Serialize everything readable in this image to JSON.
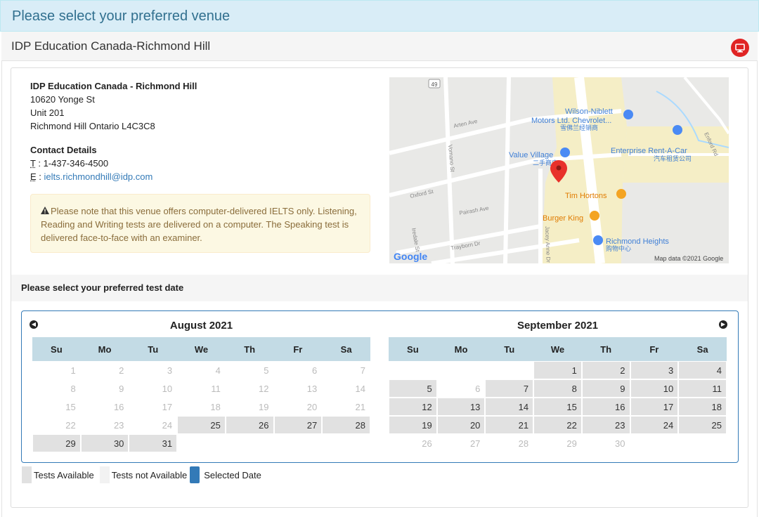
{
  "header": {
    "title": "Please select your preferred venue"
  },
  "venue_bar": {
    "name": "IDP Education Canada-Richmond Hill",
    "icon": "monitor-icon",
    "icon_color": "#e02424"
  },
  "address": {
    "title": "IDP Education Canada - Richmond Hill",
    "line1": "10620 Yonge St",
    "line2": "Unit 201",
    "line3": "Richmond Hill Ontario L4C3C8"
  },
  "contact": {
    "header": "Contact Details",
    "tel_prefix": "T",
    "tel": "1-437-346-4500",
    "email_prefix": "E",
    "email": "ielts.richmondhill@idp.com"
  },
  "note": {
    "icon": "warning-icon",
    "text": "Please note that this venue offers computer-delivered IELTS only. Listening, Reading and Writing tests are delivered on a computer. The Speaking test is delivered face-to-face with an examiner."
  },
  "map": {
    "labels": {
      "route": "49",
      "arten": "Arten Ave",
      "vomano": "Vomano St",
      "oxford": "Oxford St",
      "pairash": "Pairash Ave",
      "trayborn": "Trayborn Dr",
      "iredale": "Iredale St",
      "jacey": "Jacey Anne Dr",
      "enford": "Enford Rd",
      "wilson1": "Wilson-Niblett",
      "wilson2": "Motors Ltd. Chevrolet...",
      "wilson3": "雪佛兰经销商",
      "enterprise1": "Enterprise Rent-A-Car",
      "enterprise2": "汽车租赁公司",
      "value1": "Value Village",
      "value2": "二手商店",
      "tim": "Tim Hortons",
      "burger": "Burger King",
      "heights1": "Richmond Heights",
      "heights2": "购物中心",
      "google": "Google",
      "credit": "Map data ©2021 Google"
    }
  },
  "date_strip": {
    "label": "Please select your preferred test date"
  },
  "weekdays": [
    "Su",
    "Mo",
    "Tu",
    "We",
    "Th",
    "Fr",
    "Sa"
  ],
  "nav": {
    "prev_icon": "prev-arrow-icon",
    "next_icon": "next-arrow-icon"
  },
  "calendars": [
    {
      "title": "August 2021",
      "weeks": [
        [
          {
            "d": "1",
            "a": false
          },
          {
            "d": "2",
            "a": false
          },
          {
            "d": "3",
            "a": false
          },
          {
            "d": "4",
            "a": false
          },
          {
            "d": "5",
            "a": false
          },
          {
            "d": "6",
            "a": false
          },
          {
            "d": "7",
            "a": false
          }
        ],
        [
          {
            "d": "8",
            "a": false
          },
          {
            "d": "9",
            "a": false
          },
          {
            "d": "10",
            "a": false
          },
          {
            "d": "11",
            "a": false
          },
          {
            "d": "12",
            "a": false
          },
          {
            "d": "13",
            "a": false
          },
          {
            "d": "14",
            "a": false
          }
        ],
        [
          {
            "d": "15",
            "a": false
          },
          {
            "d": "16",
            "a": false
          },
          {
            "d": "17",
            "a": false
          },
          {
            "d": "18",
            "a": false
          },
          {
            "d": "19",
            "a": false
          },
          {
            "d": "20",
            "a": false
          },
          {
            "d": "21",
            "a": false
          }
        ],
        [
          {
            "d": "22",
            "a": false
          },
          {
            "d": "23",
            "a": false
          },
          {
            "d": "24",
            "a": false
          },
          {
            "d": "25",
            "a": true
          },
          {
            "d": "26",
            "a": true
          },
          {
            "d": "27",
            "a": true
          },
          {
            "d": "28",
            "a": true
          }
        ],
        [
          {
            "d": "29",
            "a": true
          },
          {
            "d": "30",
            "a": true
          },
          {
            "d": "31",
            "a": true
          },
          {
            "d": "",
            "a": false
          },
          {
            "d": "",
            "a": false
          },
          {
            "d": "",
            "a": false
          },
          {
            "d": "",
            "a": false
          }
        ]
      ]
    },
    {
      "title": "September 2021",
      "weeks": [
        [
          {
            "d": "",
            "a": false
          },
          {
            "d": "",
            "a": false
          },
          {
            "d": "",
            "a": false
          },
          {
            "d": "1",
            "a": true
          },
          {
            "d": "2",
            "a": true
          },
          {
            "d": "3",
            "a": true
          },
          {
            "d": "4",
            "a": true
          }
        ],
        [
          {
            "d": "5",
            "a": true
          },
          {
            "d": "6",
            "a": false
          },
          {
            "d": "7",
            "a": true
          },
          {
            "d": "8",
            "a": true
          },
          {
            "d": "9",
            "a": true
          },
          {
            "d": "10",
            "a": true
          },
          {
            "d": "11",
            "a": true
          }
        ],
        [
          {
            "d": "12",
            "a": true
          },
          {
            "d": "13",
            "a": true
          },
          {
            "d": "14",
            "a": true
          },
          {
            "d": "15",
            "a": true
          },
          {
            "d": "16",
            "a": true
          },
          {
            "d": "17",
            "a": true
          },
          {
            "d": "18",
            "a": true
          }
        ],
        [
          {
            "d": "19",
            "a": true
          },
          {
            "d": "20",
            "a": true
          },
          {
            "d": "21",
            "a": true
          },
          {
            "d": "22",
            "a": true
          },
          {
            "d": "23",
            "a": true
          },
          {
            "d": "24",
            "a": true
          },
          {
            "d": "25",
            "a": true
          }
        ],
        [
          {
            "d": "26",
            "a": false
          },
          {
            "d": "27",
            "a": false
          },
          {
            "d": "28",
            "a": false
          },
          {
            "d": "29",
            "a": false
          },
          {
            "d": "30",
            "a": false
          },
          {
            "d": "",
            "a": false
          },
          {
            "d": "",
            "a": false
          }
        ]
      ]
    }
  ],
  "legend": {
    "available": "Tests Available",
    "not_available": "Tests not Available",
    "selected": "Selected Date",
    "available_color": "#e1e1e1",
    "not_available_color": "#f2f2f2",
    "selected_color": "#337ab7"
  },
  "colors": {
    "header_bg": "#d9edf7",
    "header_text": "#31708f",
    "link": "#337ab7",
    "weekday_bg": "#c3dbe5"
  }
}
